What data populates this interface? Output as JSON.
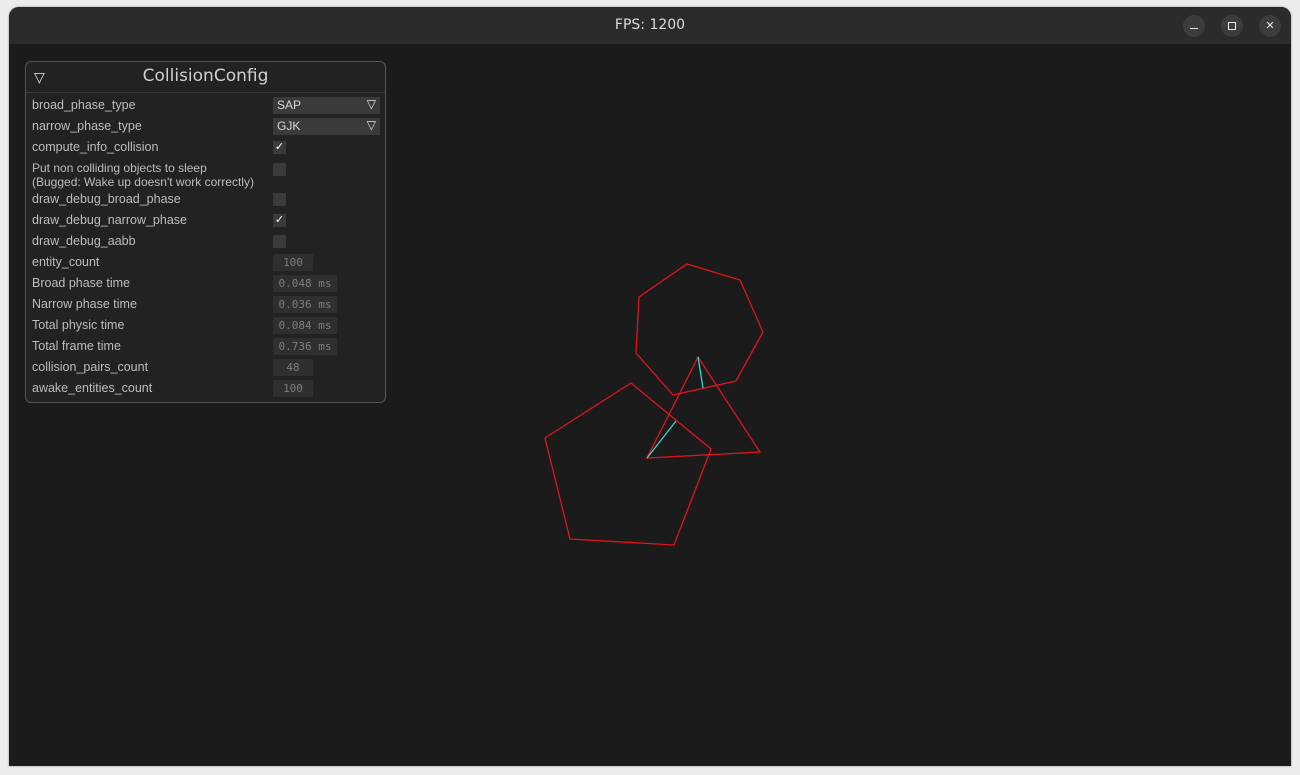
{
  "window": {
    "title": "FPS: 1200",
    "controls": {
      "minimize": "minimize-icon",
      "maximize": "maximize-icon",
      "close": "close-icon",
      "close_glyph": "✕"
    }
  },
  "panel": {
    "title": "CollisionConfig",
    "collapse_glyph": "▽",
    "dropdown_glyph": "▽",
    "check_glyph": "✓",
    "rows": {
      "broad_phase_type": {
        "label": "broad_phase_type",
        "value": "SAP"
      },
      "narrow_phase_type": {
        "label": "narrow_phase_type",
        "value": "GJK"
      },
      "compute_info_collision": {
        "label": "compute_info_collision",
        "checked": true
      },
      "sleep": {
        "label_line1": "Put non colliding objects to sleep",
        "label_line2": "(Bugged: Wake up doesn't work correctly)",
        "checked": false
      },
      "draw_debug_broad_phase": {
        "label": "draw_debug_broad_phase",
        "checked": false
      },
      "draw_debug_narrow_phase": {
        "label": "draw_debug_narrow_phase",
        "checked": true
      },
      "draw_debug_aabb": {
        "label": "draw_debug_aabb",
        "checked": false
      },
      "entity_count": {
        "label": "entity_count",
        "value": "100"
      },
      "broad_phase_time": {
        "label": "Broad phase time",
        "value": "0.048 ms"
      },
      "narrow_phase_time": {
        "label": "Narrow phase time",
        "value": "0.036 ms"
      },
      "total_physic_time": {
        "label": "Total physic time",
        "value": "0.084 ms"
      },
      "total_frame_time": {
        "label": "Total frame time",
        "value": "0.736 ms"
      },
      "collision_pairs_count": {
        "label": "collision_pairs_count",
        "value": "48"
      },
      "awake_entities_count": {
        "label": "awake_entities_count",
        "value": "100"
      }
    }
  },
  "colors": {
    "shape_outline": "#e0141c",
    "contact_line": "#35d6d6",
    "background": "#1b1b1b",
    "titlebar": "#2b2b2b"
  }
}
